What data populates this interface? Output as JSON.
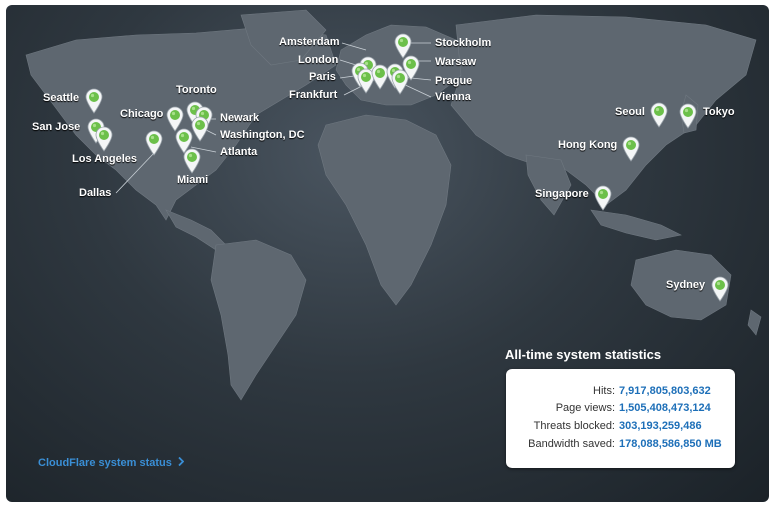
{
  "cities": [
    {
      "id": "amsterdam",
      "label": "Amsterdam"
    },
    {
      "id": "london",
      "label": "London"
    },
    {
      "id": "paris",
      "label": "Paris"
    },
    {
      "id": "frankfurt",
      "label": "Frankfurt"
    },
    {
      "id": "stockholm",
      "label": "Stockholm"
    },
    {
      "id": "warsaw",
      "label": "Warsaw"
    },
    {
      "id": "prague",
      "label": "Prague"
    },
    {
      "id": "vienna",
      "label": "Vienna"
    },
    {
      "id": "seattle",
      "label": "Seattle"
    },
    {
      "id": "san-jose",
      "label": "San Jose"
    },
    {
      "id": "los-angeles",
      "label": "Los Angeles"
    },
    {
      "id": "dallas",
      "label": "Dallas"
    },
    {
      "id": "chicago",
      "label": "Chicago"
    },
    {
      "id": "toronto",
      "label": "Toronto"
    },
    {
      "id": "newark",
      "label": "Newark"
    },
    {
      "id": "washington-dc",
      "label": "Washington, DC"
    },
    {
      "id": "atlanta",
      "label": "Atlanta"
    },
    {
      "id": "miami",
      "label": "Miami"
    },
    {
      "id": "seoul",
      "label": "Seoul"
    },
    {
      "id": "tokyo",
      "label": "Tokyo"
    },
    {
      "id": "hong-kong",
      "label": "Hong Kong"
    },
    {
      "id": "singapore",
      "label": "Singapore"
    },
    {
      "id": "sydney",
      "label": "Sydney"
    }
  ],
  "stats": {
    "title": "All-time system statistics",
    "rows": [
      {
        "label": "Hits:",
        "value": "7,917,805,803,632"
      },
      {
        "label": "Page views:",
        "value": "1,505,408,473,124"
      },
      {
        "label": "Threats blocked:",
        "value": "303,193,259,486"
      },
      {
        "label": "Bandwidth saved:",
        "value": "178,088,586,850 MB"
      }
    ]
  },
  "status_link": {
    "label": "CloudFlare system status",
    "chevron": "chevron-right-icon"
  },
  "colors": {
    "pin": "#6cc04a",
    "link": "#3a8fd6",
    "value": "#1d6fb8"
  }
}
